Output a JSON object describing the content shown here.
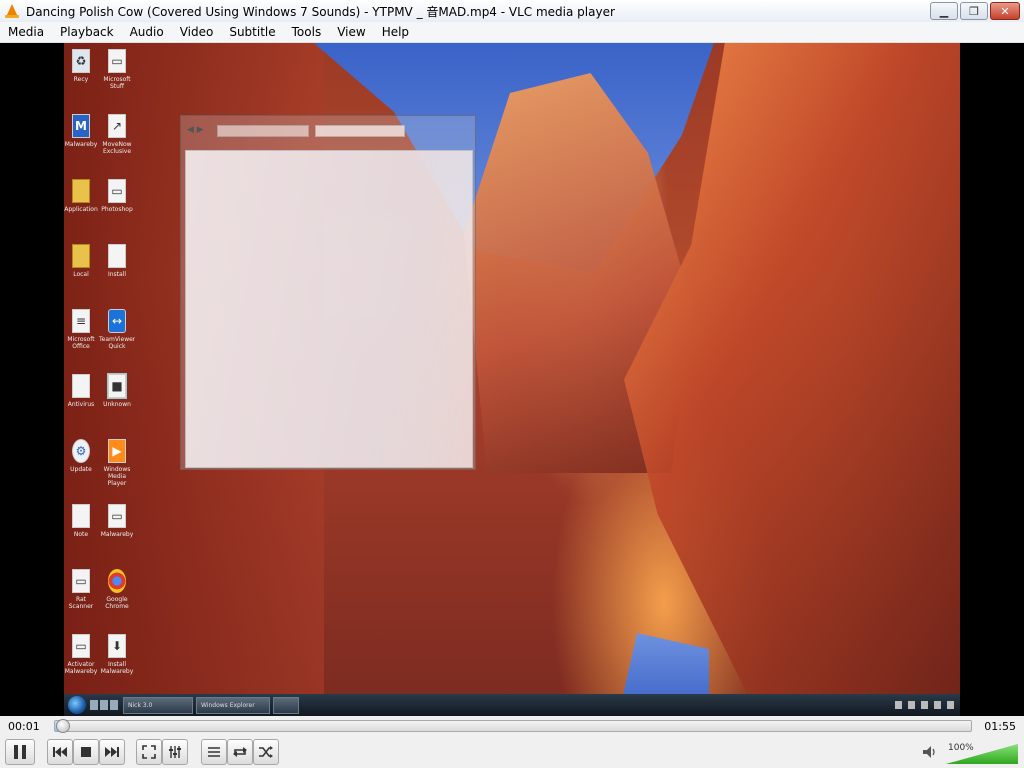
{
  "window": {
    "title": "Dancing Polish Cow (Covered Using Windows 7 Sounds) - YTPMV _ 音MAD.mp4 - VLC media player",
    "controls": {
      "minimize": "▁",
      "maximize": "❐",
      "close": "✕"
    }
  },
  "menu": [
    "Media",
    "Playback",
    "Audio",
    "Video",
    "Subtitle",
    "Tools",
    "View",
    "Help"
  ],
  "video": {
    "desktop_icons_left": [
      {
        "icon": "recycle-bin-icon",
        "label": "Recy"
      },
      {
        "icon": "malwarebytes-icon",
        "label": "Malwareby"
      },
      {
        "icon": "folder-icon",
        "label": "Application"
      },
      {
        "icon": "folder-icon",
        "label": "Local"
      },
      {
        "icon": "document-icon",
        "label": "Microsoft Office"
      },
      {
        "icon": "file-icon",
        "label": "Antivirus"
      },
      {
        "icon": "gear-icon",
        "label": "Update"
      },
      {
        "icon": "document-icon",
        "label": "Note"
      },
      {
        "icon": "file-icon",
        "label": "Rat Scanner"
      },
      {
        "icon": "file-icon",
        "label": "Activator Malwareby"
      }
    ],
    "desktop_icons_right": [
      {
        "icon": "file-icon",
        "label": "Microsoft Stuff"
      },
      {
        "icon": "shortcut-icon",
        "label": "MoveNow Exclusive"
      },
      {
        "icon": "file-icon",
        "label": "Photoshop"
      },
      {
        "icon": "document-icon",
        "label": "Install"
      },
      {
        "icon": "teamviewer-icon",
        "label": "TeamViewer Quick"
      },
      {
        "icon": "generic-app-icon",
        "label": "Unknown"
      },
      {
        "icon": "media-player-icon",
        "label": "Windows Media Player"
      },
      {
        "icon": "file-icon",
        "label": "Malwareby"
      },
      {
        "icon": "chrome-icon",
        "label": "Google Chrome"
      },
      {
        "icon": "installer-icon",
        "label": "Install Malwareby"
      }
    ],
    "taskbar": {
      "items": [
        "Nick 3.0",
        "Windows Explorer",
        ""
      ]
    }
  },
  "playback": {
    "elapsed": "00:01",
    "total": "01:55",
    "progress": 0.009
  },
  "volume": {
    "label": "100%",
    "level": 1.0
  }
}
